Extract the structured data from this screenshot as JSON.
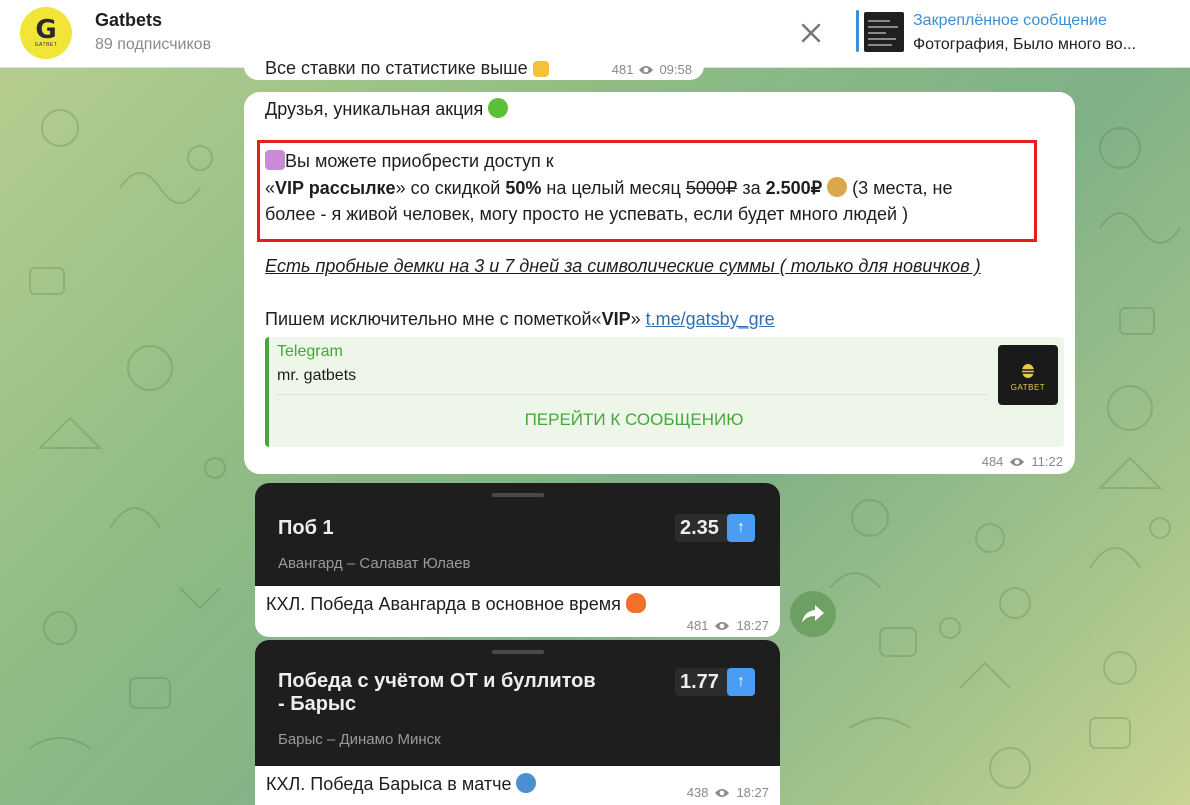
{
  "header": {
    "avatar_text": "G",
    "avatar_brand": "GATBET",
    "channel_name": "Gatbets",
    "subscribers": "89 подписчиков",
    "pinned_title": "Закреплённое сообщение",
    "pinned_text": "Фотография, Было много во..."
  },
  "prev_message": {
    "text": "Все ставки по статистике выше",
    "views": "481",
    "time": "09:58"
  },
  "post": {
    "line1": "Друзья, уникальная акция",
    "line2": "Вы можете приобрести доступ к",
    "line3_a": "«",
    "line3_b": "VIP рассылке",
    "line3_c": "» со скидкой ",
    "line3_d": "50%",
    "line3_e": " на целый месяц ",
    "line3_f": "5000₽",
    "line3_g": " за ",
    "line3_h": "2.500₽",
    "line3_i": " (3 места, не",
    "line4": "более - я живой человек, могу просто не успевать, если будет много людей )",
    "line5": "Есть пробные демки на 3 и 7 дней за символические суммы ( только для новичков )",
    "line6_a": "Пишем исключительно мне с пометкой«",
    "line6_b": "VIP",
    "line6_c": "» ",
    "link": "t.me/gatsby_gre",
    "preview_site": "Telegram",
    "preview_title": "mr. gatbets",
    "preview_button": "ПЕРЕЙТИ К СООБЩЕНИЮ",
    "preview_logo_text": "GATBET",
    "views": "484",
    "time": "11:22"
  },
  "bets": [
    {
      "title": "Поб 1",
      "odds": "2.35",
      "match": "Авангард – Салават Юлаев",
      "caption": "КХЛ. Победа Авангарда в основное время",
      "views": "481",
      "time": "18:27"
    },
    {
      "title_line1": "Победа с учётом ОТ и буллитов",
      "title_line2": "- Барыс",
      "odds": "1.77",
      "match": "Барыс – Динамо Минск",
      "caption": "КХЛ. Победа Барыса в матче",
      "views": "438",
      "time": "18:27"
    }
  ],
  "colors": {
    "accent_blue": "#3a8fd8",
    "link_green": "#45a73a",
    "highlight_red": "#e51e1e",
    "odds_badge": "#4a9df2"
  }
}
